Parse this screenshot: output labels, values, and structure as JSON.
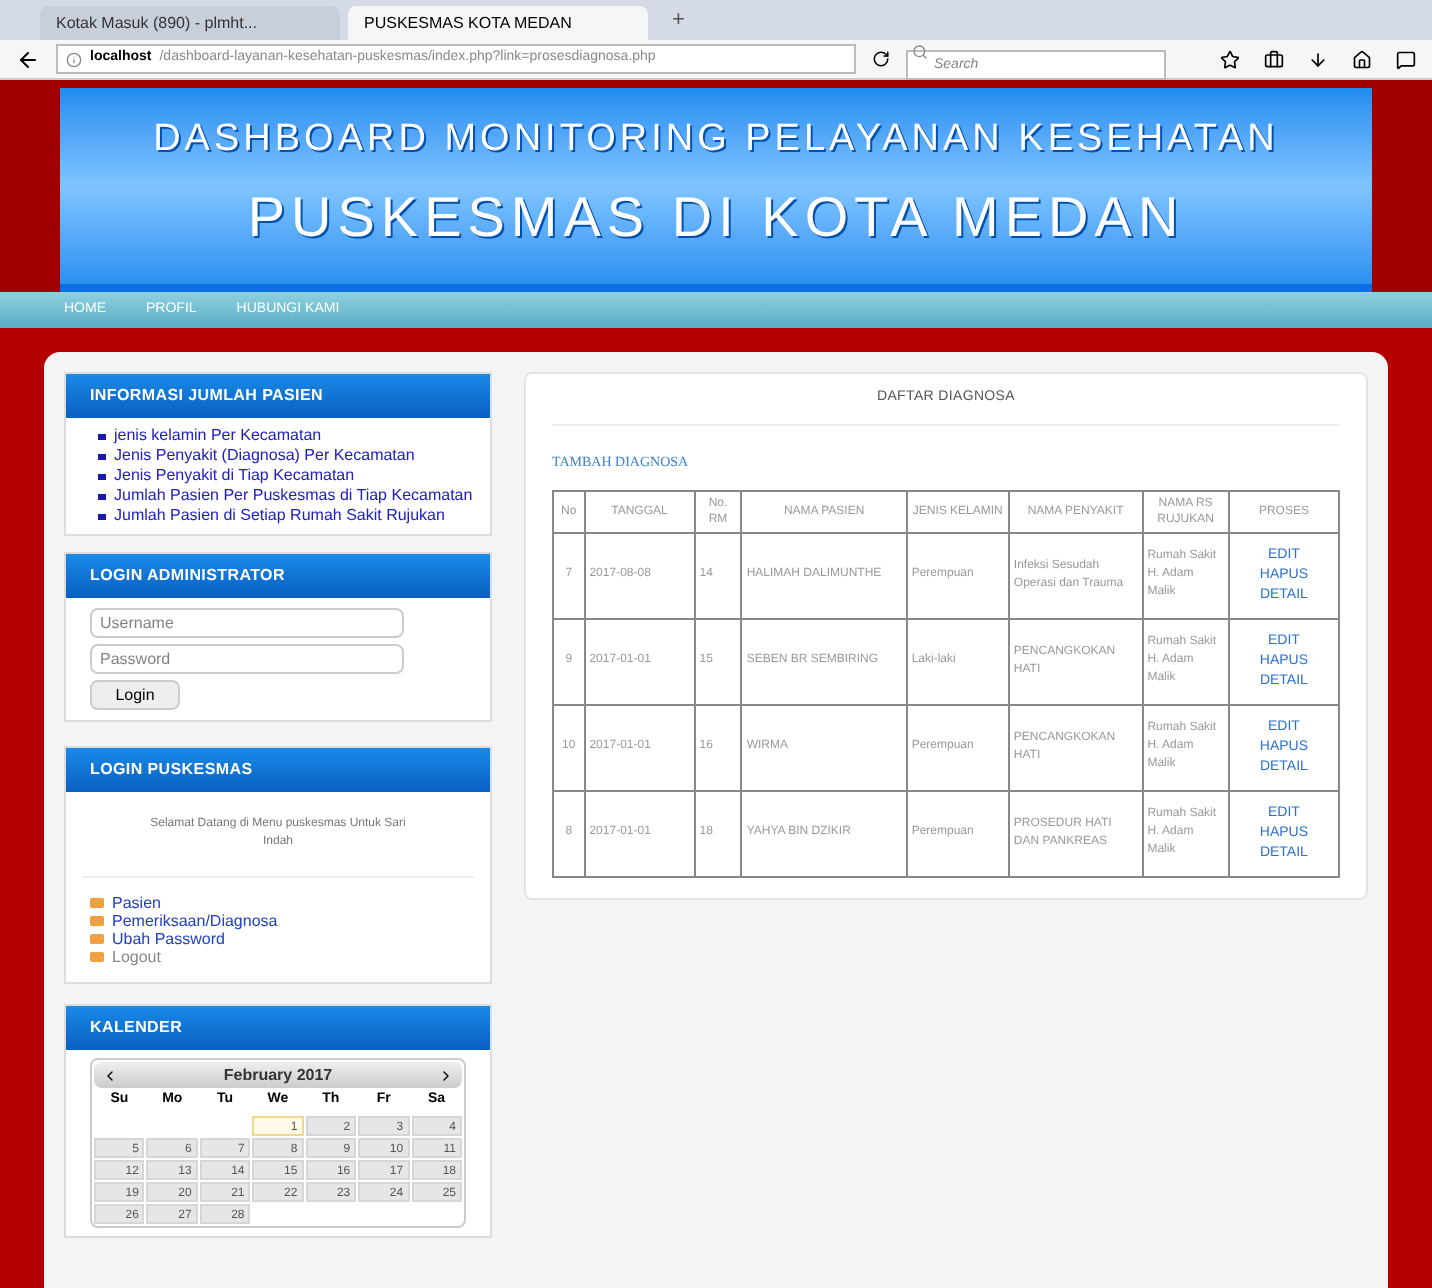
{
  "browser": {
    "tabs": [
      {
        "label": "Kotak Masuk (890) - plmht...",
        "selected": false
      },
      {
        "label": "PUSKESMAS KOTA MEDAN",
        "selected": true
      }
    ],
    "new_tab": "+",
    "url_host": "localhost",
    "url_path": "/dashboard-layanan-kesehatan-puskesmas/index.php?link=prosesdiagnosa.php",
    "search": {
      "placeholder": "Search"
    }
  },
  "banner": {
    "line_1": "DASHBOARD MONITORING PELAYANAN KESEHATAN",
    "line_2": "PUSKESMAS DI KOTA MEDAN"
  },
  "nav": [
    {
      "label": "HOME"
    },
    {
      "label": "PROFIL"
    },
    {
      "label": "HUBUNGI KAMI"
    }
  ],
  "info_panel": {
    "title": "INFORMASI JUMLAH PASIEN",
    "links": [
      "jenis kelamin Per Kecamatan",
      "Jenis Penyakit (Diagnosa) Per Kecamatan",
      "Jenis Penyakit di Tiap Kecamatan",
      "Jumlah Pasien Per Puskesmas di Tiap Kecamatan",
      "Jumlah Pasien di Setiap Rumah Sakit Rujukan"
    ]
  },
  "admin_panel": {
    "title": "LOGIN ADMINISTRATOR",
    "username": {
      "placeholder": "Username"
    },
    "password": {
      "placeholder": "Password"
    },
    "button": "Login"
  },
  "puskesmas_panel": {
    "title": "LOGIN PUSKESMAS",
    "welcome": "Selamat Datang di Menu puskesmas Untuk Sari Indah",
    "links": [
      {
        "label": "Pasien",
        "disabled": false
      },
      {
        "label": "Pemeriksaan/Diagnosa",
        "disabled": false
      },
      {
        "label": "Ubah Password",
        "disabled": false
      },
      {
        "label": "Logout",
        "disabled": true
      }
    ]
  },
  "calendar": {
    "title": "KALENDER",
    "month": "February 2017",
    "weekdays": [
      "Su",
      "Mo",
      "Tu",
      "We",
      "Th",
      "Fr",
      "Sa"
    ],
    "weeks": [
      [
        {
          "kind": "empty"
        },
        {
          "kind": "empty"
        },
        {
          "kind": "empty"
        },
        {
          "kind": "day",
          "day": "1",
          "selected": true
        },
        {
          "day": "2",
          "selected": false
        },
        {
          "day": "3",
          "selected": false
        },
        {
          "day": "4",
          "selected": false
        }
      ],
      [
        {
          "day": "5",
          "selected": false
        },
        {
          "day": "6",
          "selected": false
        },
        {
          "day": "7",
          "selected": false
        },
        {
          "day": "8",
          "selected": false
        },
        {
          "day": "9",
          "selected": false
        },
        {
          "day": "10",
          "selected": false
        },
        {
          "day": "11",
          "selected": false
        }
      ],
      [
        {
          "day": "12",
          "selected": false
        },
        {
          "day": "13",
          "selected": false
        },
        {
          "day": "14",
          "selected": false
        },
        {
          "day": "15",
          "selected": false
        },
        {
          "day": "16",
          "selected": false
        },
        {
          "day": "17",
          "selected": false
        },
        {
          "day": "18",
          "selected": false
        }
      ],
      [
        {
          "day": "19",
          "selected": false
        },
        {
          "day": "20",
          "selected": false
        },
        {
          "day": "21",
          "selected": false
        },
        {
          "day": "22",
          "selected": false
        },
        {
          "day": "23",
          "selected": false
        },
        {
          "day": "24",
          "selected": false
        },
        {
          "day": "25",
          "selected": false
        }
      ],
      [
        {
          "day": "26",
          "selected": false
        },
        {
          "day": "27",
          "selected": false
        },
        {
          "day": "28",
          "selected": false
        },
        {
          "kind": "empty"
        },
        {
          "kind": "empty"
        },
        {
          "kind": "empty"
        },
        {
          "kind": "empty"
        }
      ]
    ]
  },
  "diagnosis": {
    "title": "DAFTAR DIAGNOSA",
    "add_link": "TAMBAH DIAGNOSA",
    "columns": [
      "No",
      "TANGGAL",
      "No. RM",
      "NAMA PASIEN",
      "JENIS KELAMIN",
      "NAMA PENYAKIT",
      "NAMA RS RUJUKAN",
      "PROSES"
    ],
    "rows": [
      {
        "cells": [
          "7",
          "2017-08-08",
          "14",
          "HALIMAH DALIMUNTHE",
          "Perempuan",
          "Infeksi Sesudah Operasi dan Trauma",
          "Rumah Sakit H. Adam Malik"
        ],
        "actions": [
          "EDIT",
          "HAPUS",
          "DETAIL"
        ]
      },
      {
        "cells": [
          "9",
          "2017-01-01",
          "15",
          "SEBEN BR SEMBIRING",
          "Laki-laki",
          "PENCANGKOKAN HATI",
          "Rumah Sakit H. Adam Malik"
        ],
        "actions": [
          "EDIT",
          "HAPUS",
          "DETAIL"
        ]
      },
      {
        "cells": [
          "10",
          "2017-01-01",
          "16",
          "WIRMA",
          "Perempuan",
          "PENCANGKOKAN HATI",
          "Rumah Sakit H. Adam Malik"
        ],
        "actions": [
          "EDIT",
          "HAPUS",
          "DETAIL"
        ]
      },
      {
        "cells": [
          "8",
          "2017-01-01",
          "18",
          "YAHYA BIN DZIKIR",
          "Perempuan",
          "PROSEDUR HATI DAN PANKREAS",
          "Rumah Sakit H. Adam Malik"
        ],
        "actions": [
          "EDIT",
          "HAPUS",
          "DETAIL"
        ]
      }
    ]
  }
}
